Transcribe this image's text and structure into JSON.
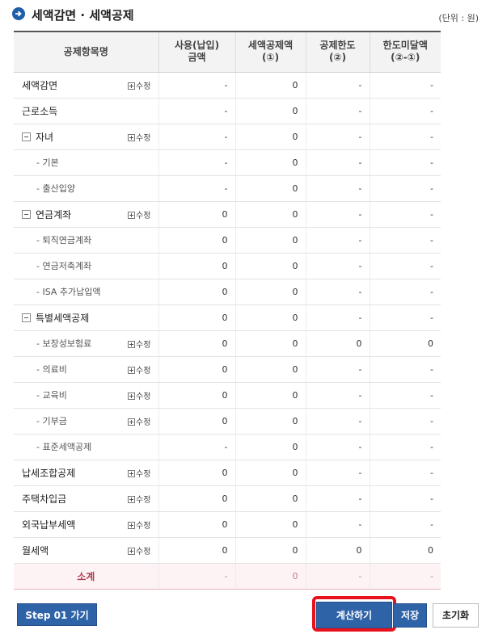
{
  "header": {
    "title": "세액감면 · 세액공제",
    "unit": "(단위 : 원)"
  },
  "table": {
    "columns": {
      "item": "공제항목명",
      "used_1": "사용(납입)",
      "used_2": "금액",
      "deduct_1": "세액공제액",
      "deduct_2": "(①)",
      "limit_1": "공제한도",
      "limit_2": "(②)",
      "short_1": "한도미달액",
      "short_2": "(②-①)"
    },
    "edit_label": "수정",
    "rows": [
      {
        "name": "세액감면",
        "level": 0,
        "edit": true,
        "used": "-",
        "deduct": "0",
        "limit": "-",
        "short": "-"
      },
      {
        "name": "근로소득",
        "level": 0,
        "edit": false,
        "used": "-",
        "deduct": "0",
        "limit": "-",
        "short": "-"
      },
      {
        "name": "자녀",
        "level": 0,
        "toggle": true,
        "edit": true,
        "used": "-",
        "deduct": "0",
        "limit": "-",
        "short": "-"
      },
      {
        "name": "- 기본",
        "level": 1,
        "edit": false,
        "used": "-",
        "deduct": "0",
        "limit": "-",
        "short": "-"
      },
      {
        "name": "- 출산입양",
        "level": 1,
        "edit": false,
        "used": "-",
        "deduct": "0",
        "limit": "-",
        "short": "-"
      },
      {
        "name": "연금계좌",
        "level": 0,
        "toggle": true,
        "edit": true,
        "used": "0",
        "deduct": "0",
        "limit": "-",
        "short": "-"
      },
      {
        "name": "- 퇴직연금계좌",
        "level": 1,
        "edit": false,
        "used": "0",
        "deduct": "0",
        "limit": "-",
        "short": "-"
      },
      {
        "name": "- 연금저축계좌",
        "level": 1,
        "edit": false,
        "used": "0",
        "deduct": "0",
        "limit": "-",
        "short": "-"
      },
      {
        "name": "- ISA 추가납입액",
        "level": 1,
        "edit": false,
        "used": "0",
        "deduct": "0",
        "limit": "-",
        "short": "-"
      },
      {
        "name": "특별세액공제",
        "level": 0,
        "toggle": true,
        "edit": false,
        "used": "0",
        "deduct": "0",
        "limit": "-",
        "short": "-"
      },
      {
        "name": "- 보장성보험료",
        "level": 1,
        "edit": true,
        "used": "0",
        "deduct": "0",
        "limit": "0",
        "short": "0"
      },
      {
        "name": "- 의료비",
        "level": 1,
        "edit": true,
        "used": "0",
        "deduct": "0",
        "limit": "-",
        "short": "-"
      },
      {
        "name": "- 교육비",
        "level": 1,
        "edit": true,
        "used": "0",
        "deduct": "0",
        "limit": "-",
        "short": "-"
      },
      {
        "name": "- 기부금",
        "level": 1,
        "edit": true,
        "used": "0",
        "deduct": "0",
        "limit": "-",
        "short": "-"
      },
      {
        "name": "- 표준세액공제",
        "level": 1,
        "edit": false,
        "used": "-",
        "deduct": "0",
        "limit": "-",
        "short": "-"
      },
      {
        "name": "납세조합공제",
        "level": 0,
        "edit": true,
        "used": "0",
        "deduct": "0",
        "limit": "-",
        "short": "-"
      },
      {
        "name": "주택차입금",
        "level": 0,
        "edit": true,
        "used": "0",
        "deduct": "0",
        "limit": "-",
        "short": "-"
      },
      {
        "name": "외국납부세액",
        "level": 0,
        "edit": true,
        "used": "0",
        "deduct": "0",
        "limit": "-",
        "short": "-"
      },
      {
        "name": "월세액",
        "level": 0,
        "edit": true,
        "used": "0",
        "deduct": "0",
        "limit": "0",
        "short": "0"
      }
    ],
    "subtotal": {
      "name": "소계",
      "used": "-",
      "deduct": "0",
      "limit": "-",
      "short": "-"
    }
  },
  "buttons": {
    "step": "Step 01 가기",
    "calc": "계산하기",
    "save": "저장",
    "reset": "초기화"
  }
}
